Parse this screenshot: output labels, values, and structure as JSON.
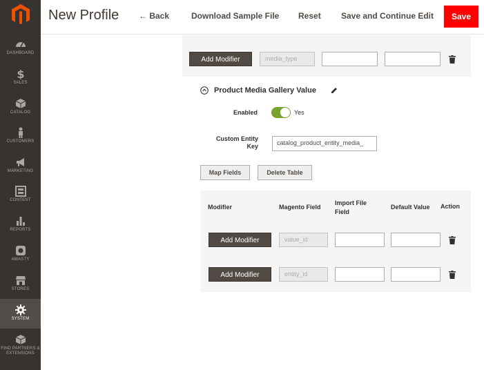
{
  "sidebar": {
    "items": [
      {
        "label": "DASHBOARD"
      },
      {
        "label": "SALES"
      },
      {
        "label": "CATALOG"
      },
      {
        "label": "CUSTOMERS"
      },
      {
        "label": "MARKETING"
      },
      {
        "label": "CONTENT"
      },
      {
        "label": "REPORTS"
      },
      {
        "label": "AMASTY"
      },
      {
        "label": "STORES"
      },
      {
        "label": "SYSTEM"
      },
      {
        "label": "FIND PARTNERS & EXTENSIONS"
      }
    ],
    "active": "SYSTEM"
  },
  "header": {
    "title": "New Profile",
    "back_label": "← Back",
    "download_label": "Download Sample File",
    "reset_label": "Reset",
    "save_continue_label": "Save and Continue Edit",
    "save_label": "Save"
  },
  "top_row": {
    "add_modifier_label": "Add Modifier",
    "magento_field": "media_type",
    "import_field": "",
    "default_value": ""
  },
  "section": {
    "title": "Product Media Gallery Value",
    "enabled_label": "Enabled",
    "enabled_value": "Yes",
    "entity_key_label_1": "Custom Entity",
    "entity_key_label_2": "Key",
    "entity_key_value": "catalog_product_entity_media_",
    "map_fields_label": "Map Fields",
    "delete_table_label": "Delete Table"
  },
  "table": {
    "headers": {
      "modifier": "Modifier",
      "magento_field": "Magento Field",
      "import_file_field_1": "Import File",
      "import_file_field_2": "Field",
      "default_value": "Default Value",
      "action": "Action"
    },
    "rows": [
      {
        "modifier_label": "Add Modifier",
        "magento_field": "value_id",
        "import_field": "",
        "default_value": ""
      },
      {
        "modifier_label": "Add Modifier",
        "magento_field": "entity_id",
        "import_field": "",
        "default_value": ""
      }
    ]
  },
  "colors": {
    "sidebar_bg": "#373330",
    "save_bg": "#ff0000",
    "toggle_on": "#79a22e",
    "dark_button": "#514943"
  }
}
